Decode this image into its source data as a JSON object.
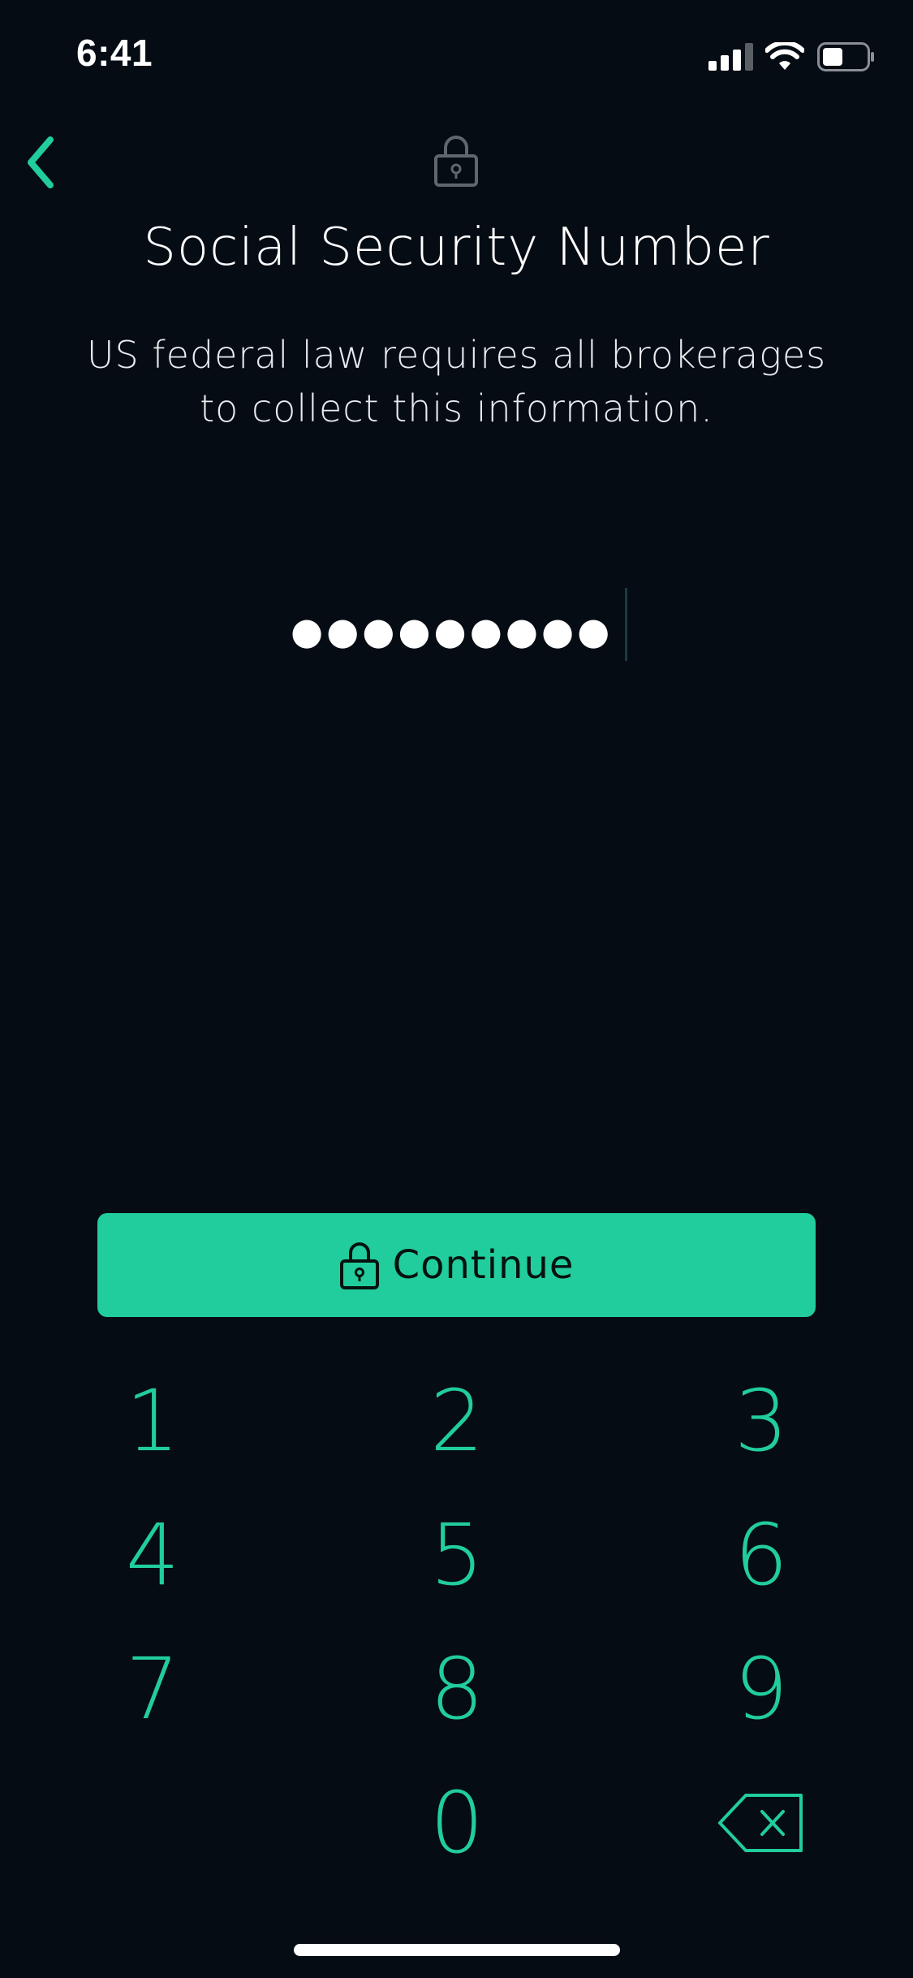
{
  "status_bar": {
    "time": "6:41",
    "icons": [
      "cellular-signal-icon",
      "wifi-icon",
      "battery-icon"
    ]
  },
  "header": {
    "back_icon": "chevron-left-icon",
    "top_icon": "lock-icon",
    "title": "Social Security Number",
    "subtitle": "US federal law requires all brokerages to collect this information."
  },
  "ssn_input": {
    "masked_value": "●●●●●●●●●",
    "digits_entered": 9
  },
  "continue_button": {
    "label": "Continue",
    "icon": "lock-icon"
  },
  "keypad": {
    "keys": [
      "1",
      "2",
      "3",
      "4",
      "5",
      "6",
      "7",
      "8",
      "9",
      "",
      "0",
      "delete"
    ],
    "delete_icon": "backspace-icon"
  },
  "colors": {
    "background": "#060c14",
    "accent": "#21cd9c",
    "text": "#ffffff"
  }
}
